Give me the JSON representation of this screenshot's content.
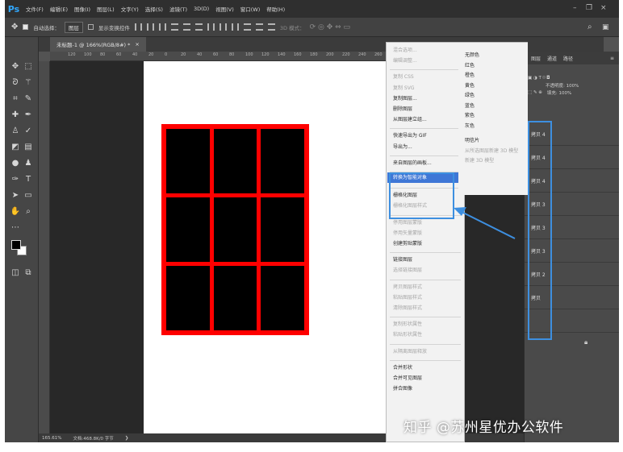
{
  "app": {
    "logo": "Ps",
    "menu": [
      "文件(F)",
      "编辑(E)",
      "图像(I)",
      "图层(L)",
      "文字(Y)",
      "选择(S)",
      "滤镜(T)",
      "3D(D)",
      "视图(V)",
      "窗口(W)",
      "帮助(H)"
    ],
    "window_controls": [
      "–",
      "❐",
      "×"
    ]
  },
  "options_bar": {
    "auto_select_label": "自动选择：",
    "auto_select_checked": true,
    "auto_select_target": "图层",
    "show_transform_label": "显示变换控件",
    "show_transform_checked": false,
    "mode_3d_label": "3D 模式："
  },
  "document": {
    "tab_title": "未标题-1 @ 166%(RGB/8#) *",
    "close_glyph": "×",
    "ruler_ticks": [
      "120",
      "100",
      "80",
      "60",
      "40",
      "20",
      "0",
      "20",
      "40",
      "60",
      "80",
      "100",
      "120",
      "140",
      "160",
      "180",
      "200",
      "220",
      "240",
      "260",
      "280",
      "300",
      "320",
      "340"
    ],
    "canvas_color": "#ffffff",
    "grid_border_color": "#ff0000",
    "grid_cell_color": "#000000",
    "grid_rows": 3,
    "grid_cols": 3
  },
  "status": {
    "zoom": "165.61%",
    "doc_info": "文档:468.8K/0 字节"
  },
  "context_menu": {
    "items": [
      {
        "label": "混合选项...",
        "enabled": false
      },
      {
        "label": "编辑调整...",
        "enabled": false
      },
      {
        "sep": true
      },
      {
        "label": "复制 CSS",
        "enabled": false
      },
      {
        "label": "复制 SVG",
        "enabled": false
      },
      {
        "label": "复制图层...",
        "enabled": true
      },
      {
        "label": "删除图层",
        "enabled": true
      },
      {
        "label": "从图层建立组...",
        "enabled": true
      },
      {
        "sep": true
      },
      {
        "label": "快速导出为 GIF",
        "enabled": true
      },
      {
        "label": "导出为...",
        "enabled": true
      },
      {
        "sep": true
      },
      {
        "label": "来自图层的画板...",
        "enabled": true
      },
      {
        "sep": true
      },
      {
        "label": "转换为智能对象",
        "enabled": true,
        "highlight": true
      },
      {
        "sep": true
      },
      {
        "label": "栅格化图层",
        "enabled": true
      },
      {
        "label": "栅格化图层样式",
        "enabled": false
      },
      {
        "sep": true
      },
      {
        "label": "停用图层蒙版",
        "enabled": false
      },
      {
        "label": "停用矢量蒙版",
        "enabled": false
      },
      {
        "label": "创建剪贴蒙版",
        "enabled": true
      },
      {
        "sep": true
      },
      {
        "label": "链接图层",
        "enabled": true
      },
      {
        "label": "选择链接图层",
        "enabled": false
      },
      {
        "sep": true
      },
      {
        "label": "拷贝图层样式",
        "enabled": false
      },
      {
        "label": "粘贴图层样式",
        "enabled": false
      },
      {
        "label": "清除图层样式",
        "enabled": false
      },
      {
        "sep": true
      },
      {
        "label": "复制形状属性",
        "enabled": false
      },
      {
        "label": "粘贴形状属性",
        "enabled": false
      },
      {
        "sep": true
      },
      {
        "label": "从隔离图层释放",
        "enabled": false
      },
      {
        "sep": true
      },
      {
        "label": "合并形状",
        "enabled": true
      },
      {
        "label": "合并可见图层",
        "enabled": true
      },
      {
        "label": "拼合图像",
        "enabled": true
      }
    ],
    "submenu": [
      {
        "label": "无颜色",
        "enabled": true
      },
      {
        "label": "红色",
        "enabled": true
      },
      {
        "label": "橙色",
        "enabled": true
      },
      {
        "label": "黄色",
        "enabled": true
      },
      {
        "label": "绿色",
        "enabled": true
      },
      {
        "label": "蓝色",
        "enabled": true
      },
      {
        "label": "紫色",
        "enabled": true
      },
      {
        "label": "灰色",
        "enabled": true
      },
      {
        "sep": true
      },
      {
        "label": "明信片",
        "enabled": true
      },
      {
        "label": "从所选图层新建 3D 模型",
        "enabled": false
      },
      {
        "label": "新建 3D 模型",
        "enabled": false
      }
    ]
  },
  "layers_panel": {
    "tabs": [
      "图层",
      "通道",
      "路径"
    ],
    "opacity_label": "不透明度: 100%",
    "fill_label": "填充: 100%",
    "layers": [
      "拷贝 4",
      "拷贝 4",
      "拷贝 4",
      "拷贝 3",
      "拷贝 3",
      "拷贝 3",
      "拷贝 2",
      "拷贝",
      ""
    ]
  },
  "watermark": "知乎 @苏州星优办公软件",
  "accent": "#3d8fe0"
}
